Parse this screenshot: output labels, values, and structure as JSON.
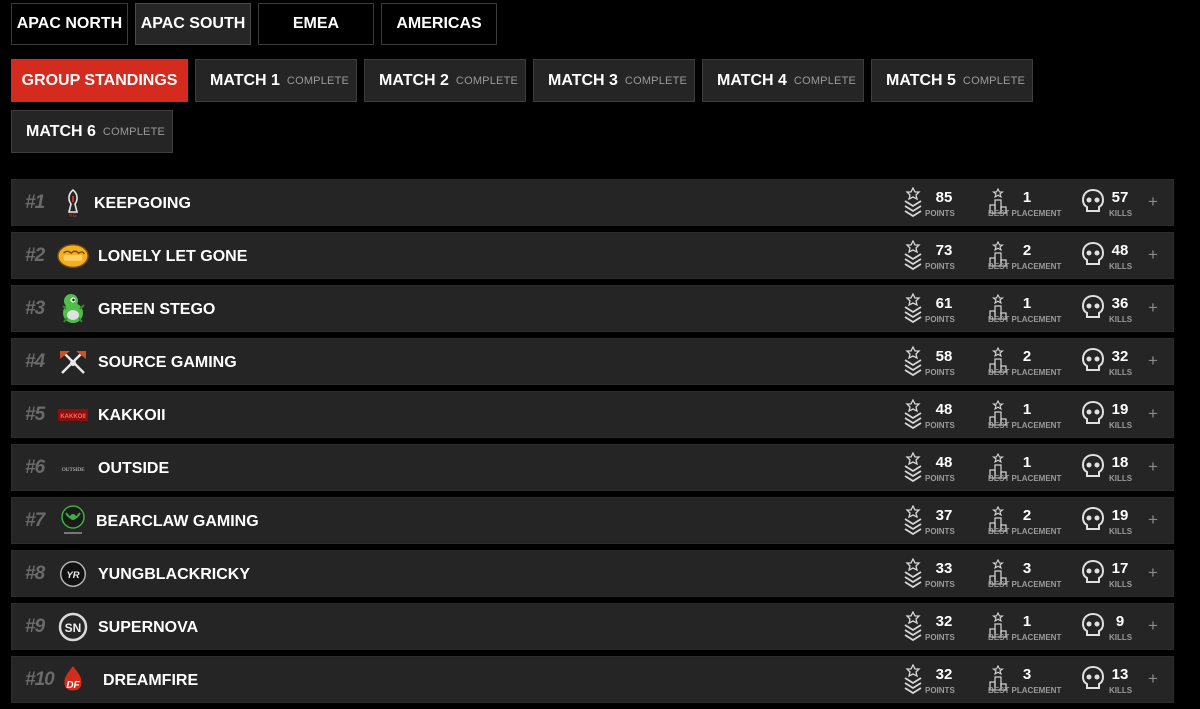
{
  "regions": [
    {
      "label": "APAC NORTH",
      "active": false
    },
    {
      "label": "APAC SOUTH",
      "active": true
    },
    {
      "label": "EMEA",
      "active": false
    },
    {
      "label": "AMERICAS",
      "active": false
    }
  ],
  "match_tabs": [
    {
      "label": "GROUP STANDINGS",
      "status": "",
      "active": true
    },
    {
      "label": "MATCH 1",
      "status": "COMPLETE",
      "active": false
    },
    {
      "label": "MATCH 2",
      "status": "COMPLETE",
      "active": false
    },
    {
      "label": "MATCH 3",
      "status": "COMPLETE",
      "active": false
    },
    {
      "label": "MATCH 4",
      "status": "COMPLETE",
      "active": false
    },
    {
      "label": "MATCH 5",
      "status": "COMPLETE",
      "active": false
    },
    {
      "label": "MATCH 6",
      "status": "COMPLETE",
      "active": false
    }
  ],
  "stat_labels": {
    "points": "POINTS",
    "best": "BEST PLACEMENT",
    "kills": "KILLS"
  },
  "expand_symbol": "+",
  "standings": [
    {
      "rank": "#1",
      "team": "KEEPGOING",
      "points": "85",
      "best": "1",
      "kills": "57",
      "logo": "keepgoing-logo"
    },
    {
      "rank": "#2",
      "team": "LONELY LET GONE",
      "points": "73",
      "best": "2",
      "kills": "48",
      "logo": "fist-logo"
    },
    {
      "rank": "#3",
      "team": "GREEN STEGO",
      "points": "61",
      "best": "1",
      "kills": "36",
      "logo": "dino-logo"
    },
    {
      "rank": "#4",
      "team": "SOURCE GAMING",
      "points": "58",
      "best": "2",
      "kills": "32",
      "logo": "axes-logo"
    },
    {
      "rank": "#5",
      "team": "KAKKOII",
      "points": "48",
      "best": "1",
      "kills": "19",
      "logo": "kakkoii-logo"
    },
    {
      "rank": "#6",
      "team": "OUTSIDE",
      "points": "48",
      "best": "1",
      "kills": "18",
      "logo": "outside-logo"
    },
    {
      "rank": "#7",
      "team": "BEARCLAW GAMING",
      "points": "37",
      "best": "2",
      "kills": "19",
      "logo": "bearclaw-logo"
    },
    {
      "rank": "#8",
      "team": "YUNGBLACKRICKY",
      "points": "33",
      "best": "3",
      "kills": "17",
      "logo": "ybr-logo"
    },
    {
      "rank": "#9",
      "team": "SUPERNOVA",
      "points": "32",
      "best": "1",
      "kills": "9",
      "logo": "supernova-logo"
    },
    {
      "rank": "#10",
      "team": "DREAMFIRE",
      "points": "32",
      "best": "3",
      "kills": "13",
      "logo": "dreamfire-logo"
    }
  ],
  "colors": {
    "accent": "#d52b1e",
    "row_bg": "#252525",
    "page_bg": "#000000"
  }
}
